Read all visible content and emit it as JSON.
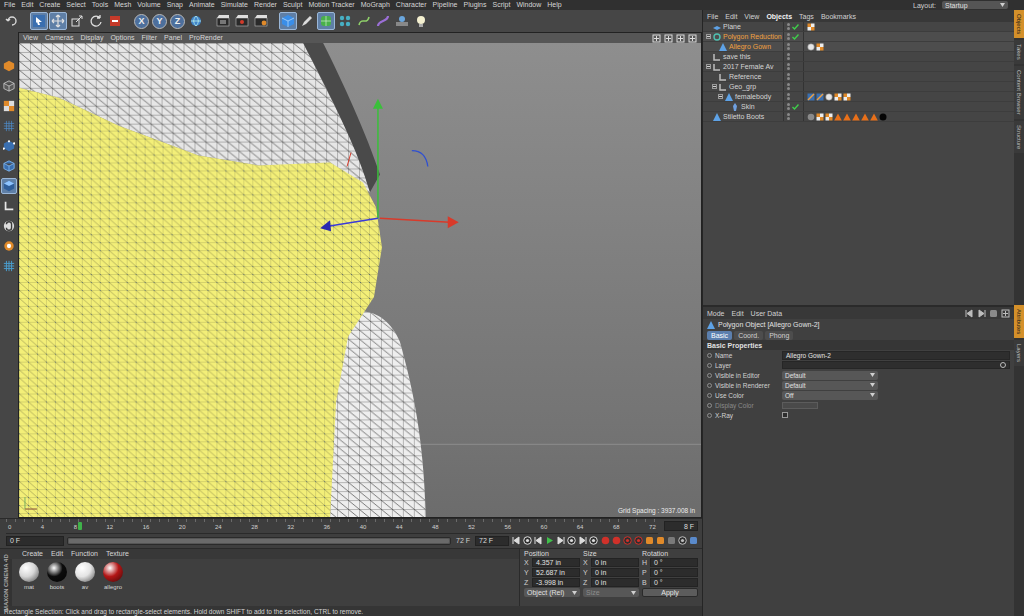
{
  "menu_bar": {
    "items": [
      "File",
      "Edit",
      "Create",
      "Select",
      "Tools",
      "Mesh",
      "Volume",
      "Snap",
      "Animate",
      "Simulate",
      "Render",
      "Sculpt",
      "Motion Tracker",
      "MoGraph",
      "Character",
      "Pipeline",
      "Plugins",
      "Script",
      "Window",
      "Help"
    ],
    "layout_label": "Layout:",
    "layout_value": "Startup"
  },
  "toolbar": [
    {
      "kind": "undo",
      "selected": false
    },
    {
      "kind": "separator",
      "selected": false
    },
    {
      "kind": "select",
      "selected": true
    },
    {
      "kind": "move",
      "selected": true
    },
    {
      "kind": "scale",
      "selected": false
    },
    {
      "kind": "rotate",
      "selected": false
    },
    {
      "kind": "recent",
      "selected": false
    },
    {
      "kind": "separator",
      "selected": false
    },
    {
      "kind": "axis",
      "label": "X",
      "selected": true
    },
    {
      "kind": "axis",
      "label": "Y",
      "selected": true
    },
    {
      "kind": "axis",
      "label": "Z",
      "selected": true
    },
    {
      "kind": "world",
      "selected": false
    },
    {
      "kind": "separator",
      "selected": false
    },
    {
      "kind": "render-view",
      "selected": false
    },
    {
      "kind": "render",
      "selected": false
    },
    {
      "kind": "render-settings",
      "selected": false
    },
    {
      "kind": "separator",
      "selected": false
    },
    {
      "kind": "cube",
      "selected": true
    },
    {
      "kind": "pen",
      "selected": false
    },
    {
      "kind": "subdivide",
      "selected": true
    },
    {
      "kind": "array",
      "selected": false
    },
    {
      "kind": "spline-gen",
      "selected": false
    },
    {
      "kind": "deformer",
      "selected": false
    },
    {
      "kind": "scene",
      "selected": false
    },
    {
      "kind": "light",
      "selected": false
    }
  ],
  "tool_strip": [
    {
      "kind": "make-editable",
      "selected": false
    },
    {
      "kind": "model",
      "selected": false
    },
    {
      "kind": "texture-mode",
      "selected": false
    },
    {
      "kind": "workplane",
      "selected": false
    },
    {
      "kind": "points",
      "selected": false
    },
    {
      "kind": "edges",
      "selected": false
    },
    {
      "kind": "polygons",
      "selected": true
    },
    {
      "kind": "axis-mode",
      "selected": false
    },
    {
      "kind": "snap",
      "selected": false
    },
    {
      "kind": "tweak",
      "selected": false
    },
    {
      "kind": "lock",
      "selected": false
    }
  ],
  "viewport": {
    "menu": [
      "View",
      "Cameras",
      "Display",
      "Options",
      "Filter",
      "Panel",
      "ProRender"
    ],
    "grid_spacing": "Grid Spacing : 3937.008 in"
  },
  "timeline": {
    "ticks": [
      "0",
      "4",
      "8",
      "12",
      "16",
      "20",
      "24",
      "28",
      "32",
      "36",
      "40",
      "44",
      "48",
      "52",
      "56",
      "60",
      "64",
      "68",
      "72"
    ],
    "current": "8 F",
    "level": 0.111,
    "start_field": "0 F",
    "range_end": "72 F",
    "end_field": "72 F"
  },
  "materials": {
    "menu": [
      "Create",
      "Edit",
      "Function",
      "Texture"
    ],
    "logo": [
      "MAXON",
      "CINEMA 4D"
    ],
    "items": [
      {
        "name": "mat",
        "color": "#d6d6d6"
      },
      {
        "name": "boots",
        "color": "#0c0c0c"
      },
      {
        "name": "av",
        "color": "#e4e4e4"
      },
      {
        "name": "allegro",
        "color": "#b31616"
      }
    ]
  },
  "coordinates": {
    "headers": [
      "Position",
      "Size",
      "Rotation"
    ],
    "rows": [
      {
        "pos_axis": "X",
        "position": "4.357 in",
        "size_axis": "X",
        "size": "0 in",
        "rot_axis": "H",
        "rotation": "0 °"
      },
      {
        "pos_axis": "Y",
        "position": "52.687 in",
        "size_axis": "Y",
        "size": "0 in",
        "rot_axis": "P",
        "rotation": "0 °"
      },
      {
        "pos_axis": "Z",
        "position": "-3.998 in",
        "size_axis": "Z",
        "size": "0 in",
        "rot_axis": "B",
        "rotation": "0 °"
      }
    ],
    "mode": "Object (Rel)",
    "size_mode": "Size",
    "size_mode_disabled": true,
    "apply": "Apply"
  },
  "objects": {
    "menu": [
      "File",
      "Edit",
      "View",
      "Objects",
      "Tags",
      "Bookmarks"
    ],
    "rows": [
      {
        "name": "Plane",
        "depth": 0,
        "kind": "plane",
        "selected": false,
        "has_children": false,
        "expanded": false,
        "checked": true,
        "tags": [
          "texture"
        ]
      },
      {
        "name": "Polygon Reduction",
        "depth": 0,
        "kind": "generator",
        "selected": true,
        "has_children": true,
        "expanded": true,
        "checked": true,
        "tags": []
      },
      {
        "name": "Allegro Gown",
        "depth": 1,
        "kind": "polygon",
        "selected": true,
        "has_children": false,
        "expanded": false,
        "checked": false,
        "tags": [
          "phong",
          "texture"
        ]
      },
      {
        "name": "save this",
        "depth": 0,
        "kind": "null",
        "selected": false,
        "has_children": false,
        "expanded": false,
        "checked": false,
        "tags": []
      },
      {
        "name": "2017 Female Av",
        "depth": 0,
        "kind": "null",
        "selected": false,
        "has_children": true,
        "expanded": true,
        "checked": false,
        "tags": []
      },
      {
        "name": "Reference",
        "depth": 1,
        "kind": "null",
        "selected": false,
        "has_children": false,
        "expanded": false,
        "checked": false,
        "tags": []
      },
      {
        "name": "Geo_grp",
        "depth": 1,
        "kind": "null",
        "selected": false,
        "has_children": true,
        "expanded": true,
        "checked": false,
        "tags": []
      },
      {
        "name": "femalebody",
        "depth": 2,
        "kind": "polygon",
        "selected": false,
        "has_children": true,
        "expanded": true,
        "checked": false,
        "tags": [
          "weight",
          "weight",
          "phong",
          "texture",
          "texture"
        ]
      },
      {
        "name": "Skin",
        "depth": 3,
        "kind": "deformer",
        "selected": false,
        "has_children": false,
        "expanded": false,
        "checked": true,
        "tags": []
      },
      {
        "name": "Stiletto Boots",
        "depth": 0,
        "kind": "polygon",
        "selected": false,
        "has_children": false,
        "expanded": false,
        "checked": false,
        "tags": [
          "material",
          "texture",
          "texture",
          "alert",
          "alert",
          "alert",
          "alert",
          "alert",
          "black"
        ]
      }
    ]
  },
  "attributes": {
    "menu": [
      "Mode",
      "Edit",
      "User Data"
    ],
    "title": "Polygon Object [Allegro Gown-2]",
    "tabs": [
      {
        "label": "Basic",
        "selected": true
      },
      {
        "label": "Coord.",
        "selected": false
      },
      {
        "label": "Phong",
        "selected": false
      }
    ],
    "section": "Basic Properties",
    "fields": [
      {
        "label": "Name",
        "kind": "text",
        "value": "Allegro Gown-2",
        "disabled": false,
        "checked": false
      },
      {
        "label": "Layer",
        "kind": "layer",
        "value": "",
        "disabled": false,
        "checked": false
      },
      {
        "label": "Visible in Editor",
        "kind": "dropdown",
        "value": "Default",
        "disabled": false,
        "checked": false
      },
      {
        "label": "Visible in Renderer",
        "kind": "dropdown",
        "value": "Default",
        "disabled": false,
        "checked": false
      },
      {
        "label": "Use Color",
        "kind": "dropdown",
        "value": "Off",
        "disabled": false,
        "checked": false
      },
      {
        "label": "Display Color",
        "kind": "color",
        "value": "",
        "disabled": true,
        "checked": false
      },
      {
        "label": "X-Ray",
        "kind": "checkbox",
        "value": "",
        "disabled": false,
        "checked": false
      }
    ]
  },
  "side_tabs": [
    {
      "label": "Objects",
      "selected": true,
      "group": "top"
    },
    {
      "label": "Takes",
      "selected": false,
      "group": "top"
    },
    {
      "label": "Content Browser",
      "selected": false,
      "group": "top"
    },
    {
      "label": "Structure",
      "selected": false,
      "group": "top"
    },
    {
      "label": "Attributes",
      "selected": true,
      "group": "bottom"
    },
    {
      "label": "Layers",
      "selected": false,
      "group": "bottom"
    }
  ],
  "status": "Rectangle Selection: Click and drag to rectangle-select elements. Hold down SHIFT to add to the selection, CTRL to remove."
}
